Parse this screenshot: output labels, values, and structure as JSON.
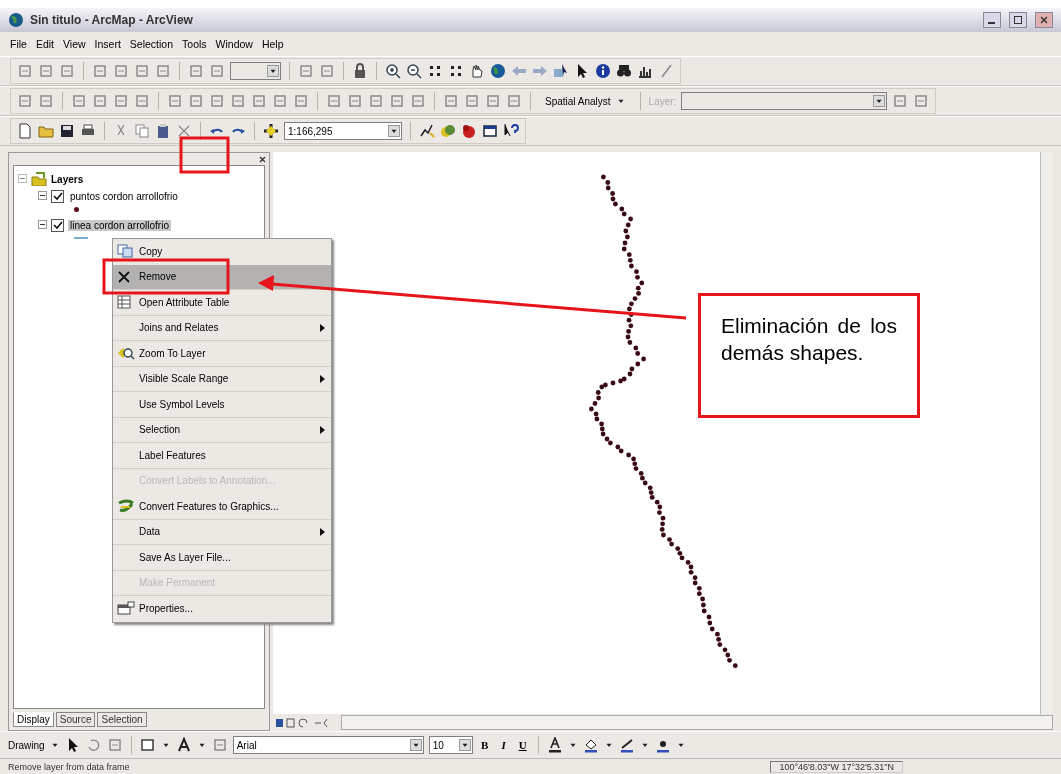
{
  "window": {
    "title": "Sin titulo - ArcMap - ArcView"
  },
  "menu_bar": [
    "File",
    "Edit",
    "View",
    "Insert",
    "Selection",
    "Tools",
    "Window",
    "Help"
  ],
  "toolbar": {
    "scale": "1:166,295",
    "spatial_analyst": "Spatial Analyst",
    "layer_label": "Layer:"
  },
  "toc": {
    "root": "Layers",
    "layers": [
      {
        "name": "puntos cordon arrollofrio",
        "checked": true,
        "kind": "point",
        "selected": false
      },
      {
        "name": "linea cordon arrollofrio",
        "checked": true,
        "kind": "line",
        "selected": true
      }
    ],
    "tabs": [
      {
        "label": "Display",
        "selected": true
      },
      {
        "label": "Source",
        "selected": false
      },
      {
        "label": "Selection",
        "selected": false
      }
    ]
  },
  "context_menu": [
    {
      "label": "Copy",
      "kind": "copy",
      "selected": false,
      "disabled": false,
      "submenu": false
    },
    {
      "label": "Remove",
      "kind": "remove",
      "selected": true,
      "disabled": false,
      "submenu": false
    },
    {
      "label": "Open Attribute Table",
      "kind": "table",
      "selected": false,
      "disabled": false,
      "submenu": false
    },
    {
      "label": "Joins and Relates",
      "kind": "plain",
      "selected": false,
      "disabled": false,
      "submenu": true
    },
    {
      "label": "Zoom To Layer",
      "kind": "zoom",
      "selected": false,
      "disabled": false,
      "submenu": false
    },
    {
      "label": "Visible Scale Range",
      "kind": "plain",
      "selected": false,
      "disabled": false,
      "submenu": true
    },
    {
      "label": "Use Symbol Levels",
      "kind": "plain",
      "selected": false,
      "disabled": false,
      "submenu": false
    },
    {
      "label": "Selection",
      "kind": "plain",
      "selected": false,
      "disabled": false,
      "submenu": true
    },
    {
      "label": "Label Features",
      "kind": "plain",
      "selected": false,
      "disabled": false,
      "submenu": false
    },
    {
      "label": "Convert Labels to Annotation...",
      "kind": "plain",
      "selected": false,
      "disabled": true,
      "submenu": false
    },
    {
      "label": "Convert Features to Graphics...",
      "kind": "convert",
      "selected": false,
      "disabled": false,
      "submenu": false
    },
    {
      "label": "Data",
      "kind": "plain",
      "selected": false,
      "disabled": false,
      "submenu": true
    },
    {
      "label": "Save As Layer File...",
      "kind": "plain",
      "selected": false,
      "disabled": false,
      "submenu": false
    },
    {
      "label": "Make Permanent",
      "kind": "plain",
      "selected": false,
      "disabled": true,
      "submenu": false
    },
    {
      "label": "Properties...",
      "kind": "properties",
      "selected": false,
      "disabled": false,
      "submenu": false
    }
  ],
  "drawing_toolbar": {
    "label": "Drawing",
    "font": "Arial",
    "size": "10",
    "bold": "B",
    "italic": "I",
    "underline": "U"
  },
  "status_bar": {
    "message": "Remove layer from data frame",
    "coordinates": "100°46'8.03\"W  17°32'5.31\"N"
  },
  "annotation": {
    "text": "Eliminación de los demás shapes."
  }
}
